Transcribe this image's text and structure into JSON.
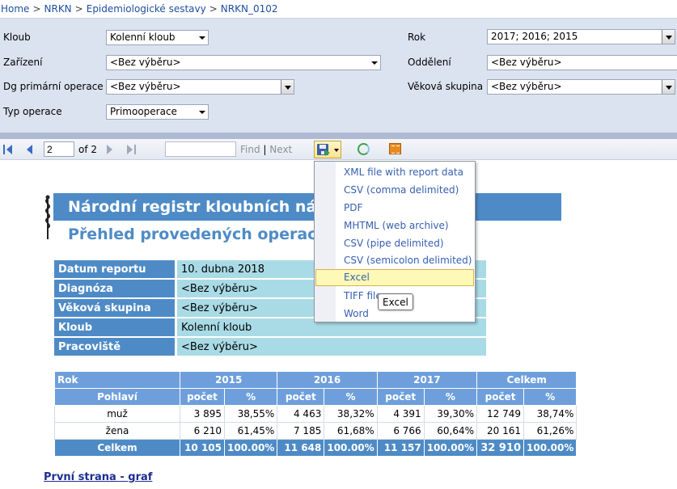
{
  "breadcrumb": {
    "items": [
      "Home",
      "NRKN",
      "Epidemiologické sestavy",
      "NRKN_0102"
    ],
    "separator": ">"
  },
  "params": {
    "klub_label": "Kloub",
    "klub_value": "Kolenní kloub",
    "zarizeni_label": "Zařízení",
    "zarizeni_value": "<Bez výběru>",
    "dg_label": "Dg primární operace",
    "dg_value": "<Bez výběru>",
    "typ_label": "Typ operace",
    "typ_value": "Primooperace",
    "rok_label": "Rok",
    "rok_value": "2017; 2016; 2015",
    "oddeleni_label": "Oddělení",
    "oddeleni_value": "<Bez výběru>",
    "vek_label": "Věková skupina",
    "vek_value": "<Bez výběru>"
  },
  "toolbar": {
    "page_value": "2",
    "of_text": "of 2",
    "find_label": "Find",
    "next_label": "Next",
    "find_separator": "|"
  },
  "export_menu": {
    "items": [
      "XML file with report data",
      "CSV (comma delimited)",
      "PDF",
      "MHTML (web archive)",
      "CSV (pipe delimited)",
      "CSV (semicolon delimited)",
      "Excel",
      "TIFF file",
      "Word"
    ],
    "active_index": 6,
    "tooltip": "Excel"
  },
  "report": {
    "title": "Národní registr kloubních náhrad",
    "subtitle": "Přehled provedených operací dle",
    "info": [
      {
        "label": "Datum reportu",
        "value": "10. dubna 2018"
      },
      {
        "label": "Diagnóza",
        "value": "<Bez výběru>"
      },
      {
        "label": "Věková skupina",
        "value": "<Bez výběru>"
      },
      {
        "label": "Kloub",
        "value": "Kolenní kloub"
      },
      {
        "label": "Pracoviště",
        "value": "<Bez výběru>"
      }
    ],
    "table": {
      "rok_label": "Rok",
      "pohlavi_label": "Pohlaví",
      "years": [
        "2015",
        "2016",
        "2017",
        "Celkem"
      ],
      "sub_cols": [
        "počet",
        "%"
      ],
      "rows": [
        {
          "label": "muž",
          "cells": [
            "3 895",
            "38,55%",
            "4 463",
            "38,32%",
            "4 391",
            "39,30%",
            "12 749",
            "38,74%"
          ]
        },
        {
          "label": "žena",
          "cells": [
            "6 210",
            "61,45%",
            "7 185",
            "61,68%",
            "6 766",
            "60,64%",
            "20 161",
            "61,26%"
          ]
        }
      ],
      "total": {
        "label": "Celkem",
        "cells": [
          "10 105",
          "100.00%",
          "11 648",
          "100.00%",
          "11 157",
          "100.00%",
          "32 910",
          "100.00%"
        ]
      }
    },
    "bottom_link": "První strana - graf"
  },
  "colors": {
    "accent": "#4e8bc6",
    "header": "#6e9fdc",
    "info_value_bg": "#a9dbe6",
    "params_bg": "#dbe3f0",
    "menu_highlight": "#fff9b8"
  }
}
